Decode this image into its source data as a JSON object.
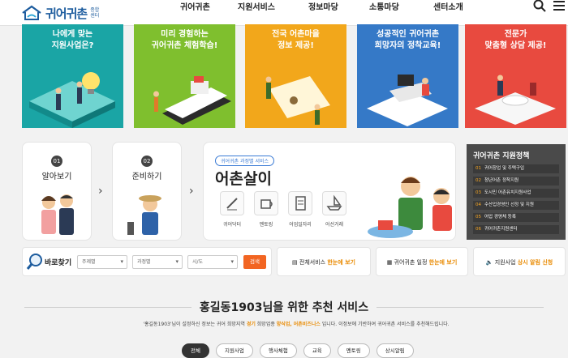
{
  "header": {
    "logo_text": "귀어귀촌",
    "logo_sub": "종합센터",
    "nav": [
      "귀어귀촌",
      "지원서비스",
      "정보마당",
      "소통마당",
      "센터소개"
    ]
  },
  "banners": [
    {
      "line1": "나에게 맞는",
      "line2": "지원사업은?",
      "color": "#1aa5a5"
    },
    {
      "line1": "미리 경험하는",
      "line2": "귀어귀촌 체험학습!",
      "color": "#7fbf2e"
    },
    {
      "line1": "전국 어촌마을",
      "line2": "정보 제공!",
      "color": "#f2a71b"
    },
    {
      "line1": "성공적인 귀어귀촌",
      "line2": "희망자의 정착교육!",
      "color": "#3579c7"
    },
    {
      "line1": "전문가",
      "line2": "맞춤형 상담 제공!",
      "color": "#e84a3f"
    }
  ],
  "steps": [
    {
      "num": "01",
      "label": "알아보기"
    },
    {
      "num": "02",
      "label": "준비하기"
    }
  ],
  "eochon": {
    "tag": "귀어귀촌 과정별 서비스",
    "title": "어촌살이",
    "icons": [
      "귀어닥터",
      "멘토링",
      "어업일자리",
      "어선거래"
    ]
  },
  "policy": {
    "title": "귀어귀촌 지원정책",
    "items": [
      {
        "num": "01",
        "text": "귀어창업 및 주택구입"
      },
      {
        "num": "02",
        "text": "청년어촌 정착지원"
      },
      {
        "num": "03",
        "text": "도시민 어촌유치지원사업"
      },
      {
        "num": "04",
        "text": "수산업경영인 선정 및 지원"
      },
      {
        "num": "05",
        "text": "어업 경영체 등록"
      },
      {
        "num": "06",
        "text": "귀어귀촌지원센터"
      }
    ]
  },
  "search": {
    "label": "바로찾기",
    "selects": [
      "주제별",
      "과정별",
      "시/도"
    ],
    "button": "검색"
  },
  "quick_links": [
    {
      "pre": "전체서비스 ",
      "hl": "한눈에 보기",
      "post": ""
    },
    {
      "pre": "귀어귀촌 일정 ",
      "hl": "한눈에 보기",
      "post": ""
    },
    {
      "pre": "지원사업 ",
      "hl": "상시 알림 신청",
      "post": ""
    }
  ],
  "recommend": {
    "title": "홍길동1903님을 위한 추천 서비스",
    "desc_pre": "'홍길동1903'님이 설정하신 정보는 귀어 희망지역 ",
    "desc_hl1": "경기",
    "desc_mid": " 희망업종 ",
    "desc_hl2": "양식업, 어촌비즈니스",
    "desc_post": " 입니다. 이정보에 기반하여 귀어귀촌 서비스를 추천해드립니다.",
    "tabs": [
      "전체",
      "지원사업",
      "행사체험",
      "교육",
      "멘토링",
      "상시알림"
    ]
  },
  "colors": {
    "accent": "#f26522",
    "brand": "#1d5c9e",
    "highlight": "#e98a00"
  }
}
